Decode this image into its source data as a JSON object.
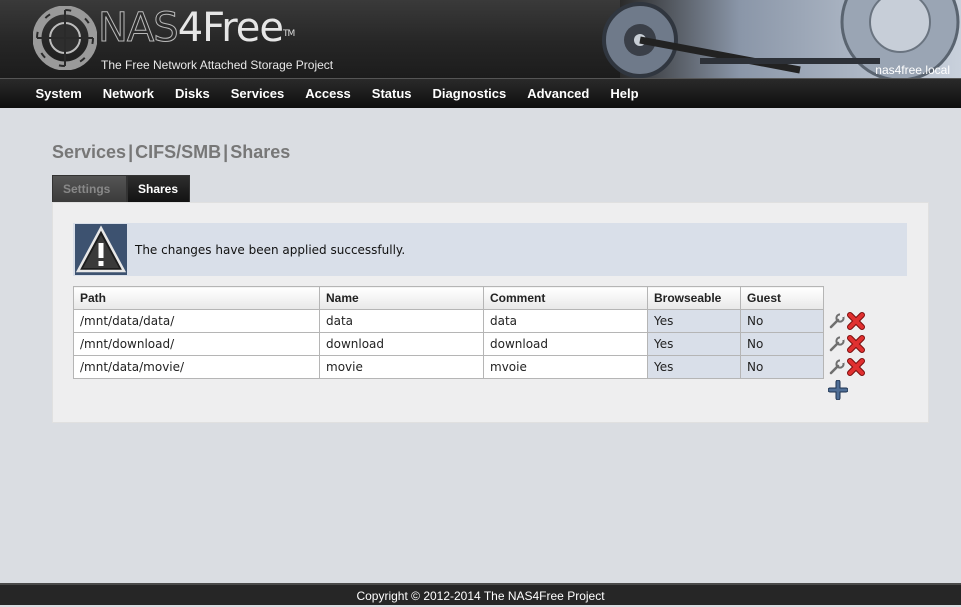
{
  "header": {
    "brand_nas": "NAS",
    "brand_four": "4Free",
    "brand_tm": "TM",
    "tagline": "The Free Network Attached Storage Project",
    "hostname": "nas4free.local"
  },
  "nav": {
    "items": [
      "System",
      "Network",
      "Disks",
      "Services",
      "Access",
      "Status",
      "Diagnostics",
      "Advanced",
      "Help"
    ]
  },
  "title": {
    "part1": "Services",
    "part2": "CIFS/SMB",
    "part3": "Shares",
    "sep": "|"
  },
  "tabs": {
    "settings": "Settings",
    "shares": "Shares"
  },
  "alert": {
    "message": "The changes have been applied successfully."
  },
  "table": {
    "headers": [
      "Path",
      "Name",
      "Comment",
      "Browseable",
      "Guest"
    ],
    "rows": [
      [
        "/mnt/data/data/",
        "data",
        "data",
        "Yes",
        "No"
      ],
      [
        "/mnt/download/",
        "download",
        "download",
        "Yes",
        "No"
      ],
      [
        "/mnt/data/movie/",
        "movie",
        "mvoie",
        "Yes",
        "No"
      ]
    ]
  },
  "icons": {
    "edit": "wrench-icon",
    "delete": "red-x-icon",
    "add": "plus-icon",
    "warning": "warning-icon"
  },
  "colors": {
    "nav_bg": "#111111",
    "alert_bg": "#d9dfe9",
    "delete_red": "#cc1e1e",
    "add_blue": "#3c5a7e"
  },
  "footer": {
    "text": "Copyright © 2012-2014 The NAS4Free Project"
  }
}
